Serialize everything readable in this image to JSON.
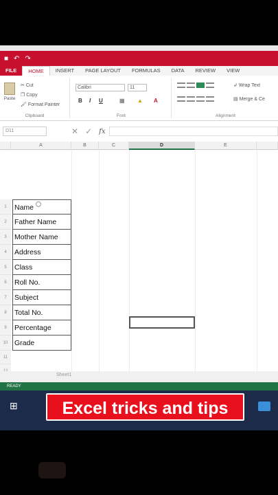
{
  "ribbon_tabs": [
    "FILE",
    "HOME",
    "INSERT",
    "PAGE LAYOUT",
    "FORMULAS",
    "DATA",
    "REVIEW",
    "VIEW"
  ],
  "active_tab": "HOME",
  "clipboard": {
    "paste_label": "Paste",
    "cut_label": "Cut",
    "copy_label": "Copy",
    "format_painter_label": "Format Painter",
    "group_label": "Clipboard"
  },
  "font_group": {
    "font_name": "Calibri",
    "font_size": "11",
    "bold": "B",
    "italic": "I",
    "underline": "U",
    "group_label": "Font"
  },
  "alignment_group": {
    "wrap_text_label": "Wrap Text",
    "merge_label": "Merge & Ce",
    "group_label": "Alignment"
  },
  "formula_bar": {
    "name_box": "D11",
    "fx_label": "fx",
    "value": ""
  },
  "columns": [
    {
      "label": "A",
      "selected": false
    },
    {
      "label": "B",
      "selected": false
    },
    {
      "label": "C",
      "selected": false
    },
    {
      "label": "D",
      "selected": true
    },
    {
      "label": "E",
      "selected": false
    }
  ],
  "row_numbers": [
    "1",
    "2",
    "3",
    "4",
    "5",
    "6",
    "7",
    "8",
    "9",
    "10",
    "11",
    "12"
  ],
  "column_a_cells": [
    "Name",
    "Father Name",
    "Mother Name",
    "Address",
    "Class",
    "Roll No.",
    "Subject",
    "Total No.",
    "Percentage",
    "Grade"
  ],
  "sheet_tab": "Sheet1",
  "status_text": "READY",
  "caption": "Excel tricks and tips",
  "colors": {
    "title_bar": "#c8102e",
    "status_bar": "#217346",
    "caption_bg": "#e8101c"
  }
}
